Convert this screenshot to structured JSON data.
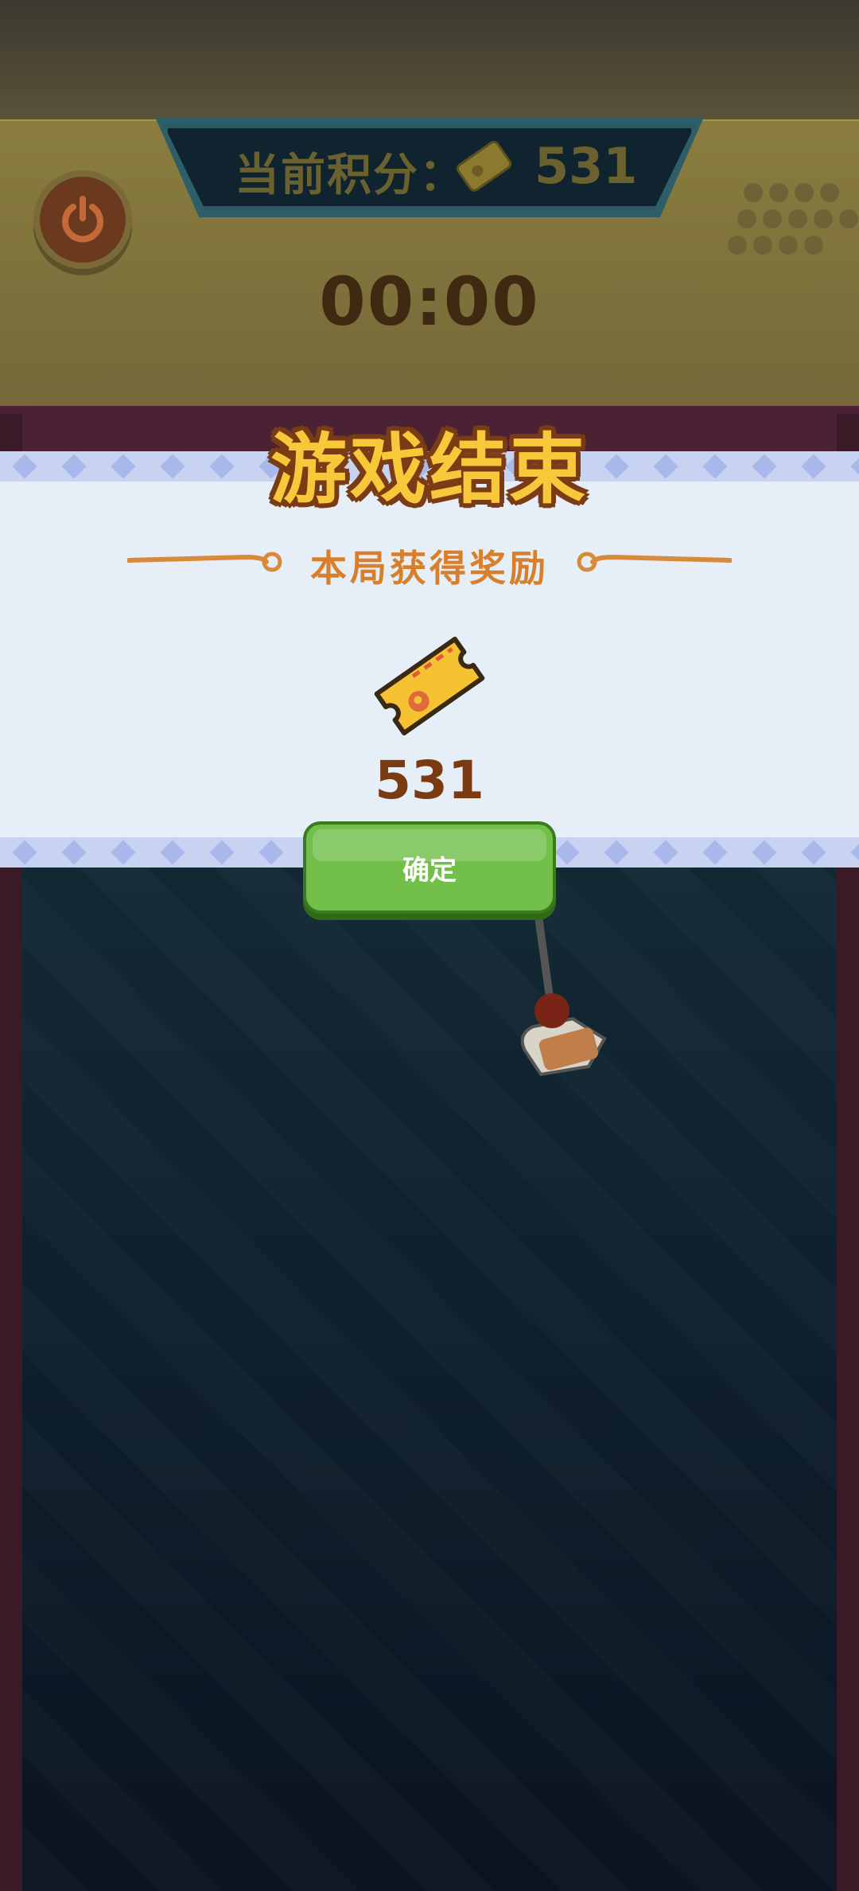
{
  "hud": {
    "score_label": "当前积分：",
    "score_value": "531",
    "timer": "00:00",
    "power_icon": "power-icon",
    "ticket_icon": "ticket-icon"
  },
  "modal": {
    "title": "游戏结束",
    "subtitle": "本局获得奖励",
    "reward_icon": "ticket-icon",
    "reward_value": "531",
    "confirm_label": "确定"
  },
  "colors": {
    "title_fill": "#f8c73a",
    "title_outline": "#7a3c14",
    "subtitle": "#d87f2b",
    "button": "#72bf4a",
    "ticket": "#f5c232"
  }
}
